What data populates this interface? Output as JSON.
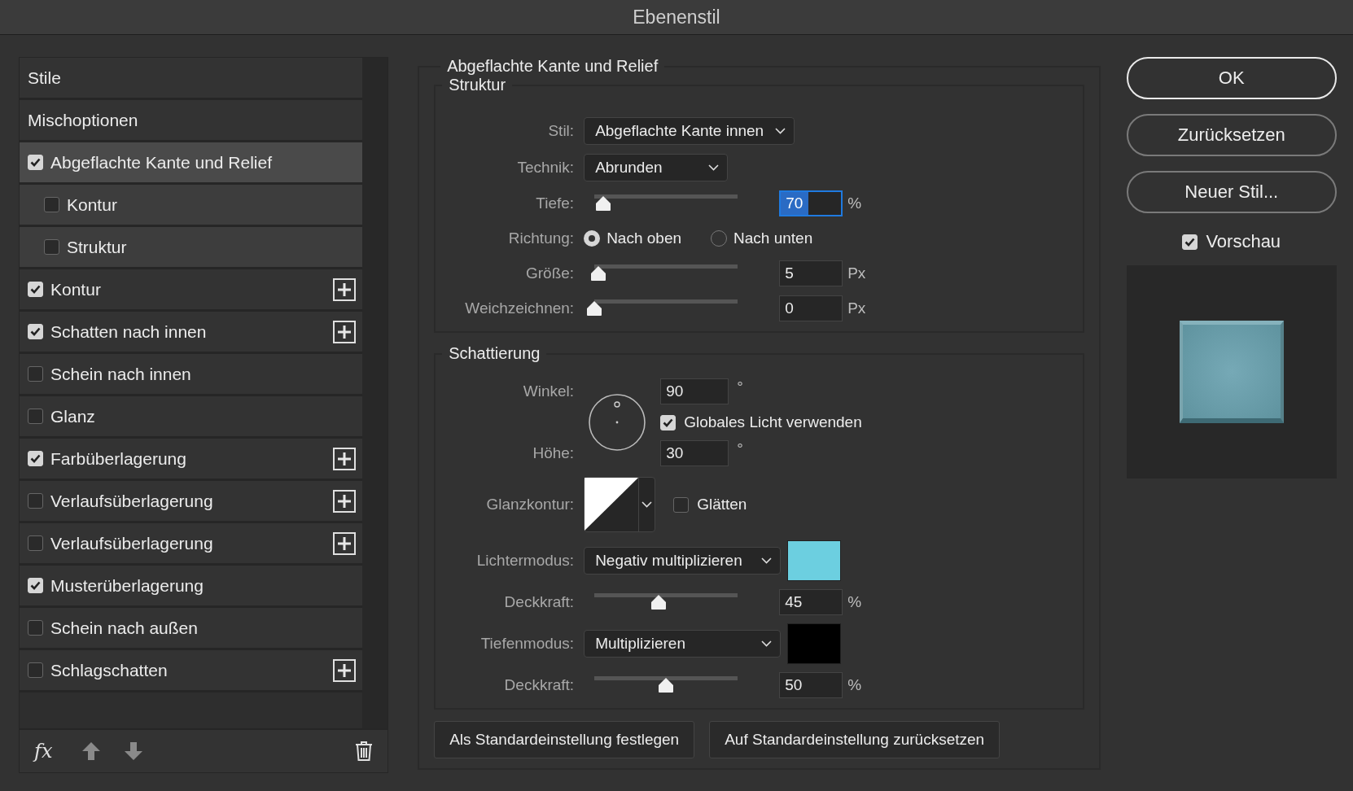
{
  "window": {
    "title": "Ebenenstil"
  },
  "sidebar": {
    "items": [
      {
        "kind": "header",
        "label": "Stile",
        "selected": false
      },
      {
        "kind": "header",
        "label": "Mischoptionen",
        "selected": false
      },
      {
        "kind": "effect",
        "label": "Abgeflachte Kante und Relief",
        "checked": true,
        "selected": true,
        "addable": false,
        "children": [
          {
            "kind": "effect",
            "label": "Kontur",
            "checked": false,
            "selected": false,
            "addable": false
          },
          {
            "kind": "effect",
            "label": "Struktur",
            "checked": false,
            "selected": false,
            "addable": false
          }
        ]
      },
      {
        "kind": "effect",
        "label": "Kontur",
        "checked": true,
        "selected": false,
        "addable": true
      },
      {
        "kind": "effect",
        "label": "Schatten nach innen",
        "checked": true,
        "selected": false,
        "addable": true
      },
      {
        "kind": "effect",
        "label": "Schein nach innen",
        "checked": false,
        "selected": false,
        "addable": false
      },
      {
        "kind": "effect",
        "label": "Glanz",
        "checked": false,
        "selected": false,
        "addable": false
      },
      {
        "kind": "effect",
        "label": "Farbüberlagerung",
        "checked": true,
        "selected": false,
        "addable": true
      },
      {
        "kind": "effect",
        "label": "Verlaufsüberlagerung",
        "checked": false,
        "selected": false,
        "addable": true
      },
      {
        "kind": "effect",
        "label": "Verlaufsüberlagerung",
        "checked": false,
        "selected": false,
        "addable": true
      },
      {
        "kind": "effect",
        "label": "Musterüberlagerung",
        "checked": true,
        "selected": false,
        "addable": false
      },
      {
        "kind": "effect",
        "label": "Schein nach außen",
        "checked": false,
        "selected": false,
        "addable": false
      },
      {
        "kind": "effect",
        "label": "Schlagschatten",
        "checked": false,
        "selected": false,
        "addable": true
      }
    ],
    "fx_label": "fx"
  },
  "panel": {
    "title": "Abgeflachte Kante und Relief",
    "struktur": {
      "title": "Struktur",
      "rows": [
        {
          "kind": "dropdown",
          "label": "Stil:",
          "value": "Abgeflachte Kante innen"
        },
        {
          "kind": "dropdown",
          "label": "Technik:",
          "value": "Abrunden"
        },
        {
          "kind": "slider",
          "label": "Tiefe:",
          "level": 0.06,
          "value": "70",
          "unit": "%",
          "focused": true
        },
        {
          "kind": "radio",
          "label": "Richtung:",
          "options": [
            {
              "label": "Nach oben",
              "selected": true
            },
            {
              "label": "Nach unten",
              "selected": false
            }
          ]
        },
        {
          "kind": "slider",
          "label": "Größe:",
          "level": 0.03,
          "value": "5",
          "unit": "Px",
          "focused": false
        },
        {
          "kind": "slider",
          "label": "Weichzeichnen:",
          "level": 0,
          "value": "0",
          "unit": "Px",
          "focused": false
        }
      ]
    },
    "schattierung": {
      "title": "Schattierung",
      "winkel": {
        "label": "Winkel:",
        "value": "90",
        "unit": "°"
      },
      "global_light": {
        "label": "Globales Licht verwenden",
        "checked": true
      },
      "hoehe": {
        "label": "Höhe:",
        "value": "30",
        "unit": "°"
      },
      "glanzkontur": {
        "label": "Glanzkontur:"
      },
      "glaetten": {
        "label": "Glätten",
        "checked": false
      },
      "rows": [
        {
          "kind": "mode",
          "label": "Lichtermodus:",
          "value": "Negativ multiplizieren",
          "color": "#6ccfe0"
        },
        {
          "kind": "slider",
          "label": "Deckkraft:",
          "level": 0.45,
          "value": "45",
          "unit": "%",
          "focused": false
        },
        {
          "kind": "mode",
          "label": "Tiefenmodus:",
          "value": "Multiplizieren",
          "color": "#000000"
        },
        {
          "kind": "slider",
          "label": "Deckkraft:",
          "level": 0.5,
          "value": "50",
          "unit": "%",
          "focused": false
        }
      ]
    },
    "buttons": [
      "Als Standardeinstellung festlegen",
      "Auf Standardeinstellung zurücksetzen"
    ]
  },
  "actions": {
    "buttons": [
      {
        "label": "OK",
        "default": true
      },
      {
        "label": "Zurücksetzen",
        "default": false
      },
      {
        "label": "Neuer Stil...",
        "default": false
      }
    ],
    "preview": {
      "label": "Vorschau",
      "checked": true
    }
  }
}
